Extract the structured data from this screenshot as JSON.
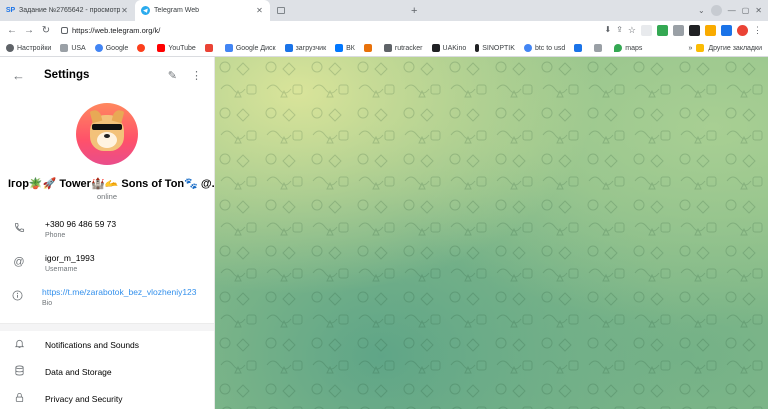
{
  "browser": {
    "tabs": [
      {
        "title": "Задание №2765642 - просмотр з",
        "favicon": "SP",
        "active": false
      },
      {
        "title": "Telegram Web",
        "favicon": "telegram-icon",
        "active": true
      },
      {
        "title": "",
        "favicon": "page-icon",
        "active": false
      }
    ],
    "url": "https://web.telegram.org/k/",
    "bookmarks": [
      {
        "label": "Настройки",
        "color": "#5f6368"
      },
      {
        "label": "USA",
        "color": "#9aa0a6"
      },
      {
        "label": "Google",
        "color": "#4285f4"
      },
      {
        "label": "",
        "color": "#fc3f1d"
      },
      {
        "label": "YouTube",
        "color": "#ff0000"
      },
      {
        "label": "",
        "color": "#ea4335"
      },
      {
        "label": "Google Диск",
        "color": "#4285f4"
      },
      {
        "label": "загрузчик",
        "color": "#1a73e8"
      },
      {
        "label": "ВК",
        "color": "#0077ff"
      },
      {
        "label": "",
        "color": "#e8710a"
      },
      {
        "label": "rutracker",
        "color": "#5f6368"
      },
      {
        "label": "UAKino",
        "color": "#202124"
      },
      {
        "label": "SINOPTIK",
        "color": "#202124"
      },
      {
        "label": "btc to usd",
        "color": "#4285f4"
      },
      {
        "label": "",
        "color": "#1a73e8"
      },
      {
        "label": "",
        "color": "#9aa0a6"
      },
      {
        "label": "maps",
        "color": "#34a853"
      }
    ],
    "other_bookmarks": "Другие закладки"
  },
  "settings": {
    "title": "Settings",
    "profile": {
      "name": "Ігор🪴🚀 Tower🏰🫴 Sons of Ton🐾 @...",
      "status": "online"
    },
    "info": [
      {
        "icon": "phone-icon",
        "value": "+380 96 486 59 73",
        "label": "Phone"
      },
      {
        "icon": "at-icon",
        "value": "igor_m_1993",
        "label": "Username"
      },
      {
        "icon": "info-icon",
        "value": "https://t.me/zarabotok_bez_vlozheniy123",
        "label": "Bio"
      }
    ],
    "menu": [
      {
        "icon": "bell-icon",
        "label": "Notifications and Sounds"
      },
      {
        "icon": "database-icon",
        "label": "Data and Storage"
      },
      {
        "icon": "lock-icon",
        "label": "Privacy and Security"
      }
    ]
  }
}
